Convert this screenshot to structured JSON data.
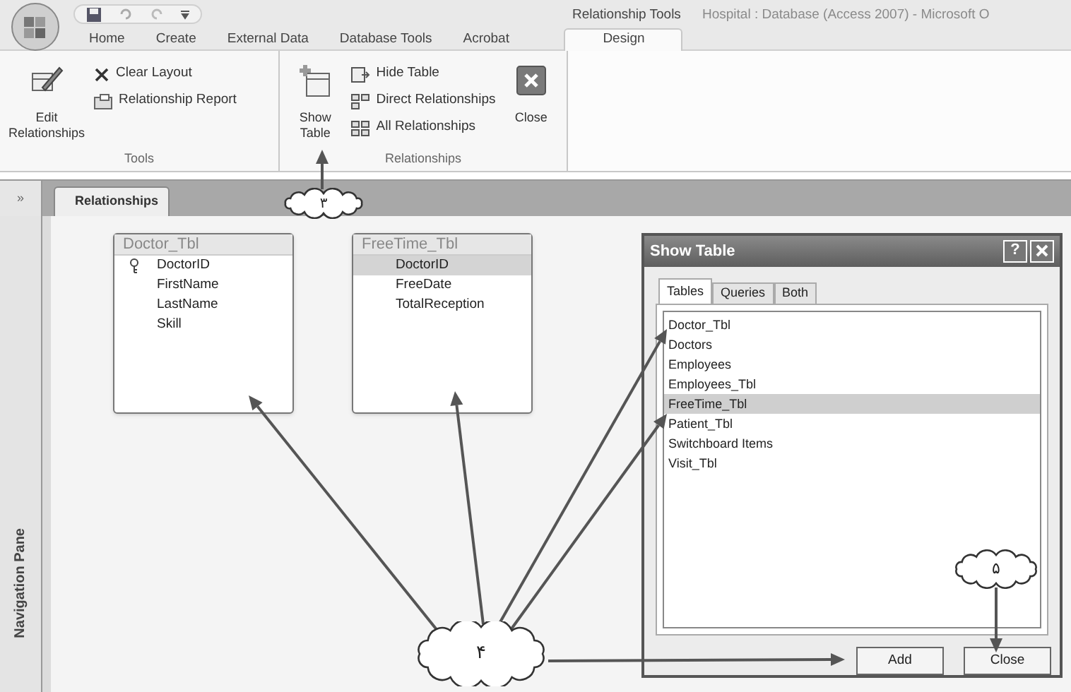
{
  "contextual_tab_group": "Relationship Tools",
  "window_title": "Hospital : Database (Access 2007) - Microsoft O",
  "tabs": [
    {
      "label": "Home",
      "selected": false
    },
    {
      "label": "Create",
      "selected": false
    },
    {
      "label": "External Data",
      "selected": false
    },
    {
      "label": "Database Tools",
      "selected": false
    },
    {
      "label": "Acrobat",
      "selected": false
    },
    {
      "label": "Design",
      "selected": true
    }
  ],
  "ribbon_groups": [
    {
      "title": "Tools",
      "commands": [
        {
          "label": "Edit Relationships",
          "kind": "large"
        },
        {
          "label": "Clear Layout",
          "kind": "small"
        },
        {
          "label": "Relationship Report",
          "kind": "small"
        }
      ]
    },
    {
      "title": "Relationships",
      "commands": [
        {
          "label": "Show Table",
          "kind": "large"
        },
        {
          "label": "Hide Table",
          "kind": "small"
        },
        {
          "label": "Direct Relationships",
          "kind": "small"
        },
        {
          "label": "All Relationships",
          "kind": "small"
        },
        {
          "label": "Close",
          "kind": "large"
        }
      ]
    }
  ],
  "nav_toggle": "»",
  "document_tab": "Relationships",
  "navigation_pane": "Navigation Pane",
  "tables": [
    {
      "title": "Doctor_Tbl",
      "fields": [
        {
          "name": "DoctorID",
          "primary_key": true,
          "selected": false
        },
        {
          "name": "FirstName",
          "primary_key": false,
          "selected": false
        },
        {
          "name": "LastName",
          "primary_key": false,
          "selected": false
        },
        {
          "name": "Skill",
          "primary_key": false,
          "selected": false
        }
      ]
    },
    {
      "title": "FreeTime_Tbl",
      "fields": [
        {
          "name": "DoctorID",
          "primary_key": false,
          "selected": true
        },
        {
          "name": "FreeDate",
          "primary_key": false,
          "selected": false
        },
        {
          "name": "TotalReception",
          "primary_key": false,
          "selected": false
        }
      ]
    }
  ],
  "dialog": {
    "title": "Show Table",
    "help": "?",
    "tabs": [
      {
        "label": "Tables",
        "selected": true
      },
      {
        "label": "Queries",
        "selected": false
      },
      {
        "label": "Both",
        "selected": false
      }
    ],
    "items": [
      {
        "label": "Doctor_Tbl",
        "selected": false
      },
      {
        "label": "Doctors",
        "selected": false
      },
      {
        "label": "Employees",
        "selected": false
      },
      {
        "label": "Employees_Tbl",
        "selected": false
      },
      {
        "label": "FreeTime_Tbl",
        "selected": true
      },
      {
        "label": "Patient_Tbl",
        "selected": false
      },
      {
        "label": "Switchboard Items",
        "selected": false
      },
      {
        "label": "Visit_Tbl",
        "selected": false
      }
    ],
    "buttons": [
      "Add",
      "Close"
    ]
  },
  "callouts": [
    {
      "label": "۳"
    },
    {
      "label": "۴"
    },
    {
      "label": "۵"
    }
  ]
}
